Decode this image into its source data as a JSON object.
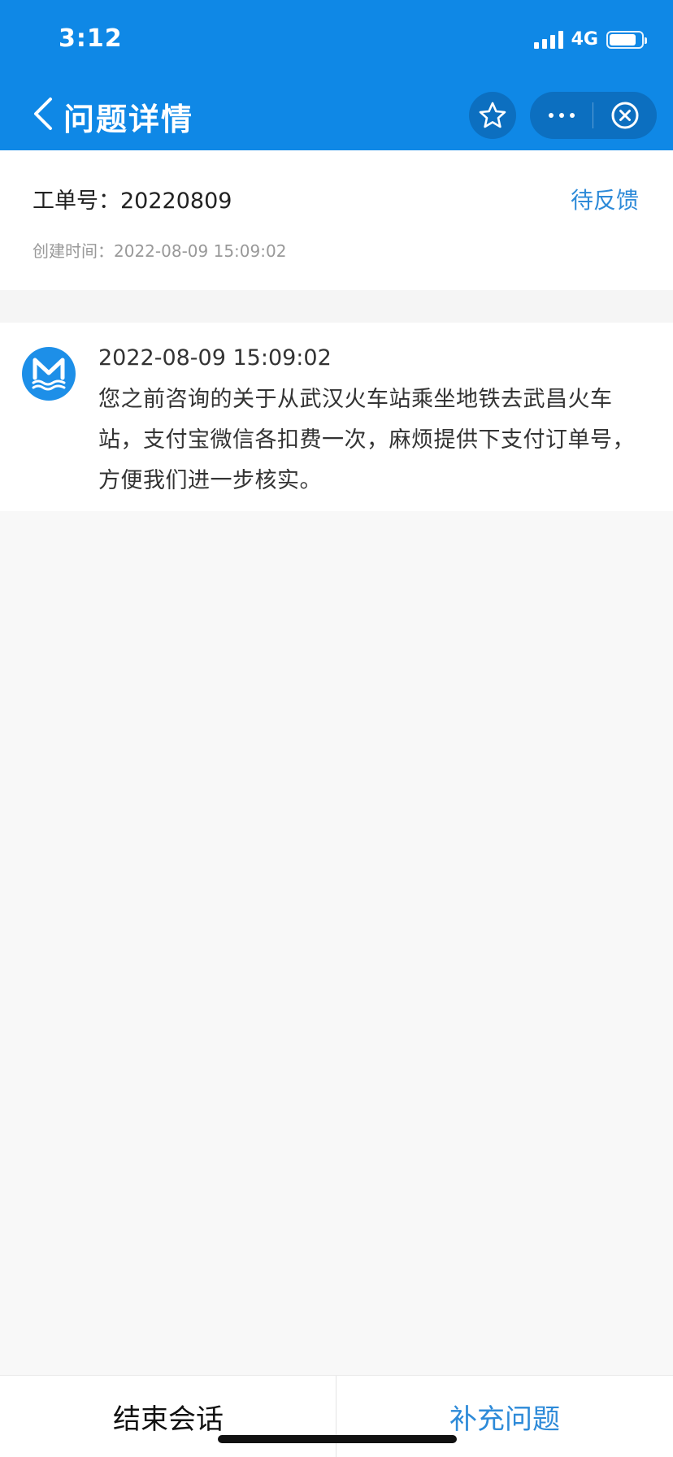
{
  "status_bar": {
    "time": "3:12",
    "network": "4G",
    "battery_level": 0.85
  },
  "nav": {
    "title": "问题详情",
    "back_icon": "chevron-left-icon",
    "favorite_icon": "star-icon",
    "more_icon": "more-dots-icon",
    "close_icon": "close-circle-icon"
  },
  "ticket": {
    "number_label": "工单号：",
    "number_value": "20220809",
    "status": "待反馈",
    "created_label": "创建时间：",
    "created_value": "2022-08-09 15:09:02"
  },
  "message": {
    "time": "2022-08-09 15:09:02",
    "text": "您之前咨询的关于从武汉火车站乘坐地铁去武昌火车站，支付宝微信各扣费一次，麻烦提供下支付订单号，方便我们进一步核实。",
    "avatar_icon": "metro-logo-icon"
  },
  "bottom": {
    "end_label": "结束会话",
    "supplement_label": "补充问题"
  },
  "colors": {
    "header_bg": "#0f88e6",
    "accent": "#2d8ad8"
  }
}
